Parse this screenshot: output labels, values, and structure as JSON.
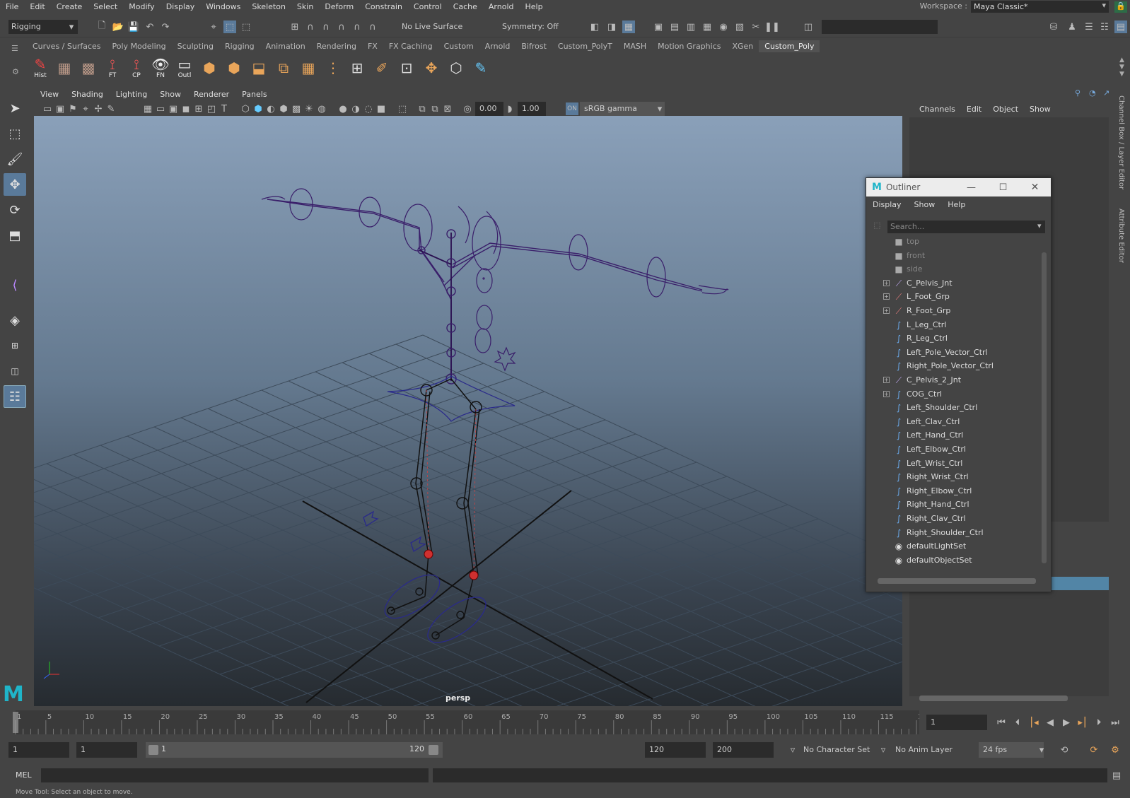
{
  "menubar": {
    "items": [
      "File",
      "Edit",
      "Create",
      "Select",
      "Modify",
      "Display",
      "Windows",
      "Skeleton",
      "Skin",
      "Deform",
      "Constrain",
      "Control",
      "Cache",
      "Arnold",
      "Help"
    ],
    "workspace_label": "Workspace :",
    "workspace_value": "Maya Classic*"
  },
  "statusline": {
    "mode": "Rigging",
    "live_surface": "No Live Surface",
    "symmetry": "Symmetry: Off"
  },
  "shelf": {
    "tabs": [
      "Curves / Surfaces",
      "Poly Modeling",
      "Sculpting",
      "Rigging",
      "Animation",
      "Rendering",
      "FX",
      "FX Caching",
      "Custom",
      "Arnold",
      "Bifrost",
      "Custom_PolyT",
      "MASH",
      "Motion Graphics",
      "XGen",
      "Custom_Poly"
    ],
    "active_tab": "Custom_Poly",
    "buttons": [
      "Hist",
      "",
      "",
      "FT",
      "CP",
      "FN",
      "Outl"
    ]
  },
  "viewport": {
    "menu": [
      "View",
      "Shading",
      "Lighting",
      "Show",
      "Renderer",
      "Panels"
    ],
    "exposure": "0.00",
    "gamma": "1.00",
    "color_space": "sRGB gamma",
    "camera_label": "persp"
  },
  "channel_box": {
    "menu": [
      "Channels",
      "Edit",
      "Object",
      "Show"
    ],
    "side_tab_1": "Channel Box / Layer Editor",
    "side_tab_2": "Attribute Editor"
  },
  "outliner": {
    "title": "Outliner",
    "menu": [
      "Display",
      "Show",
      "Help"
    ],
    "search_placeholder": "Search...",
    "items": [
      {
        "label": "top",
        "icon": "camera-icon",
        "expand": false,
        "dim": true
      },
      {
        "label": "front",
        "icon": "camera-icon",
        "expand": false,
        "dim": true
      },
      {
        "label": "side",
        "icon": "camera-icon",
        "expand": false,
        "dim": true
      },
      {
        "label": "C_Pelvis_Jnt",
        "icon": "joint-icon",
        "expand": true,
        "dim": false
      },
      {
        "label": "L_Foot_Grp",
        "icon": "ik-handle-icon",
        "expand": true,
        "dim": false
      },
      {
        "label": "R_Foot_Grp",
        "icon": "ik-handle-icon",
        "expand": true,
        "dim": false
      },
      {
        "label": "L_Leg_Ctrl",
        "icon": "curve-icon",
        "expand": false,
        "dim": false
      },
      {
        "label": "R_Leg_Ctrl",
        "icon": "curve-icon",
        "expand": false,
        "dim": false
      },
      {
        "label": "Left_Pole_Vector_Ctrl",
        "icon": "curve-icon",
        "expand": false,
        "dim": false
      },
      {
        "label": "Right_Pole_Vector_Ctrl",
        "icon": "curve-icon",
        "expand": false,
        "dim": false
      },
      {
        "label": "C_Pelvis_2_Jnt",
        "icon": "joint-icon",
        "expand": true,
        "dim": false
      },
      {
        "label": "COG_Ctrl",
        "icon": "curve-icon",
        "expand": true,
        "dim": false
      },
      {
        "label": "Left_Shoulder_Ctrl",
        "icon": "curve-icon",
        "expand": false,
        "dim": false
      },
      {
        "label": "Left_Clav_Ctrl",
        "icon": "curve-icon",
        "expand": false,
        "dim": false
      },
      {
        "label": "Left_Hand_Ctrl",
        "icon": "curve-icon",
        "expand": false,
        "dim": false
      },
      {
        "label": "Left_Elbow_Ctrl",
        "icon": "curve-icon",
        "expand": false,
        "dim": false
      },
      {
        "label": "Left_Wrist_Ctrl",
        "icon": "curve-icon",
        "expand": false,
        "dim": false
      },
      {
        "label": "Right_Wrist_Ctrl",
        "icon": "curve-icon",
        "expand": false,
        "dim": false
      },
      {
        "label": "Right_Elbow_Ctrl",
        "icon": "curve-icon",
        "expand": false,
        "dim": false
      },
      {
        "label": "Right_Hand_Ctrl",
        "icon": "curve-icon",
        "expand": false,
        "dim": false
      },
      {
        "label": "Right_Clav_Ctrl",
        "icon": "curve-icon",
        "expand": false,
        "dim": false
      },
      {
        "label": "Right_Shoulder_Ctrl",
        "icon": "curve-icon",
        "expand": false,
        "dim": false
      },
      {
        "label": "defaultLightSet",
        "icon": "set-icon",
        "expand": false,
        "dim": false
      },
      {
        "label": "defaultObjectSet",
        "icon": "set-icon",
        "expand": false,
        "dim": false
      }
    ]
  },
  "timeline": {
    "ticks": [
      "1",
      "5",
      "10",
      "15",
      "20",
      "25",
      "30",
      "35",
      "40",
      "45",
      "50",
      "55",
      "60",
      "65",
      "70",
      "75",
      "80",
      "85",
      "90",
      "95",
      "100",
      "105",
      "110",
      "115",
      "120"
    ],
    "current_frame": "1"
  },
  "range": {
    "start": "1",
    "playback_start": "1",
    "slider_start": "1",
    "slider_end": "120",
    "playback_end": "120",
    "end": "200",
    "character_set": "No Character Set",
    "anim_layer": "No Anim Layer",
    "fps": "24 fps"
  },
  "command": {
    "language": "MEL"
  },
  "helpline": "Move Tool: Select an object to move."
}
